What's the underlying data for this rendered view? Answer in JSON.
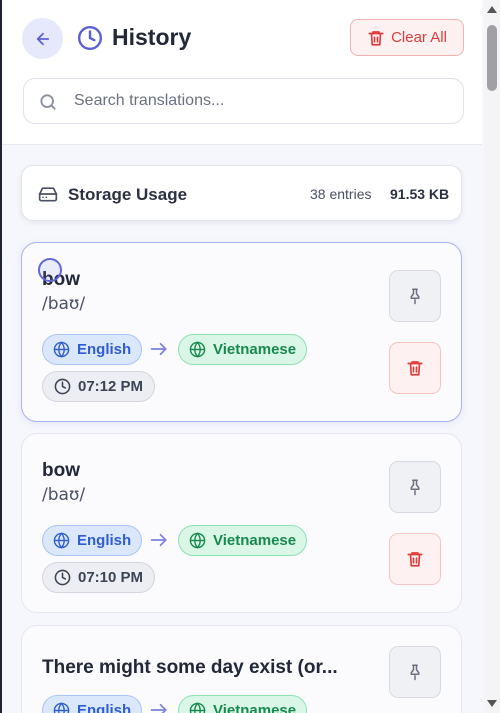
{
  "header": {
    "title": "History",
    "clear_label": "Clear All"
  },
  "search": {
    "placeholder": "Search translations...",
    "value": ""
  },
  "storage": {
    "title": "Storage Usage",
    "entries": "38 entries",
    "size": "91.53 KB"
  },
  "entries": [
    {
      "word": "bow",
      "phonetic": "/baʊ/",
      "source_lang": "English",
      "target_lang": "Vietnamese",
      "time": "07:12 PM"
    },
    {
      "word": "bow",
      "phonetic": "/baʊ/",
      "source_lang": "English",
      "target_lang": "Vietnamese",
      "time": "07:10 PM"
    },
    {
      "word": "There might some day exist (or...",
      "source_lang": "English",
      "target_lang": "Vietnamese"
    }
  ],
  "colors": {
    "accent": "#5b5fd6",
    "danger": "#e03c3c",
    "source_lang": "#2f5fcf",
    "target_lang": "#188a4f"
  }
}
